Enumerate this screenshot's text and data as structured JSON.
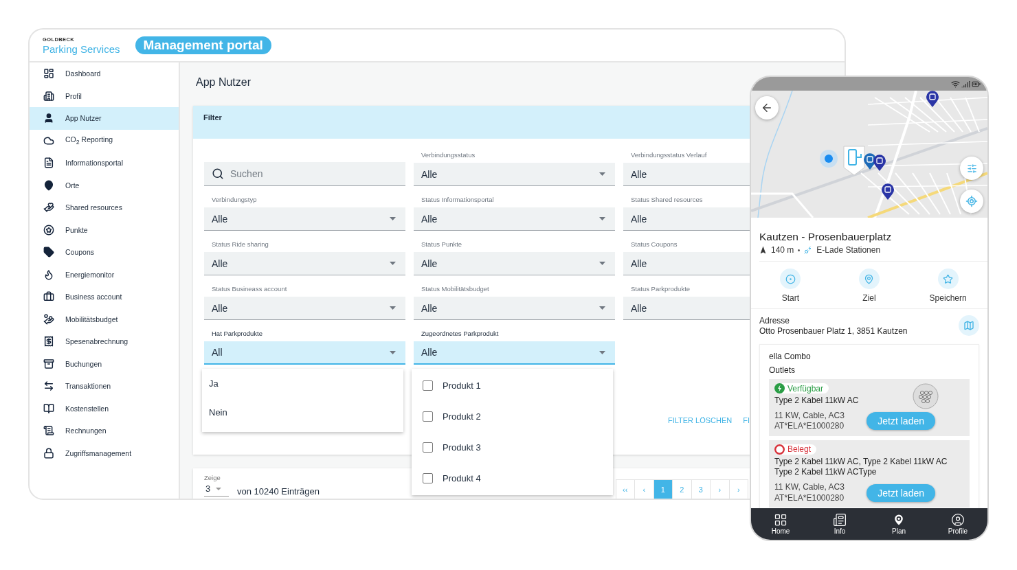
{
  "header": {
    "company": "GOLDBECK",
    "brand": "Parking Services",
    "badge": "Management portal"
  },
  "sidebar": {
    "items": [
      {
        "label": "Dashboard",
        "selected": false
      },
      {
        "label": "Profil",
        "selected": false
      },
      {
        "label": "App Nutzer",
        "selected": true
      },
      {
        "label": "CO$_{2}$ Reporting",
        "selected": false
      },
      {
        "label": "Informationsportal",
        "selected": false
      },
      {
        "label": "Orte",
        "selected": false
      },
      {
        "label": "Shared resources",
        "selected": false
      },
      {
        "label": "Punkte",
        "selected": false
      },
      {
        "label": "Coupons",
        "selected": false
      },
      {
        "label": "Energiemonitor",
        "selected": false
      },
      {
        "label": "Business account",
        "selected": false
      },
      {
        "label": "Mobilitätsbudget",
        "selected": false
      },
      {
        "label": "Spesenabrechnung",
        "selected": false
      },
      {
        "label": "Buchungen",
        "selected": false
      },
      {
        "label": "Transaktionen",
        "selected": false
      },
      {
        "label": "Kostenstellen",
        "selected": false
      },
      {
        "label": "Rechnungen",
        "selected": false
      },
      {
        "label": "Zugriffsmanagement",
        "selected": false
      }
    ]
  },
  "page": {
    "title": "App Nutzer"
  },
  "filter": {
    "title": "Filter",
    "fields": [
      {
        "kind": "search",
        "placeholder": "Suchen"
      },
      {
        "kind": "select",
        "label": "Verbindungsstatus",
        "value": "Alle",
        "open": false
      },
      {
        "kind": "select",
        "label": "Verbindungsstatus Verlauf",
        "value": "Alle",
        "open": false
      },
      {
        "kind": "select",
        "label": "Verbindungstyp",
        "value": "Alle",
        "open": false
      },
      {
        "kind": "select",
        "label": "Status Informationsportal",
        "value": "Alle",
        "open": false
      },
      {
        "kind": "select",
        "label": "Status Shared resources",
        "value": "Alle",
        "open": false
      },
      {
        "kind": "select",
        "label": "Status Ride sharing",
        "value": "Alle",
        "open": false
      },
      {
        "kind": "select",
        "label": "Status Punkte",
        "value": "Alle",
        "open": false
      },
      {
        "kind": "select",
        "label": "Status Coupons",
        "value": "Alle",
        "open": false
      },
      {
        "kind": "select",
        "label": "Status Busineass account",
        "value": "Alle",
        "open": false
      },
      {
        "kind": "select",
        "label": "Status Mobilitätsbudget",
        "value": "Alle",
        "open": false
      },
      {
        "kind": "select",
        "label": "Status Parkprodukte",
        "value": "Alle",
        "open": false
      },
      {
        "kind": "select",
        "label": "Hat Parkprodukte",
        "value": "All",
        "open": true,
        "menu": {
          "kind": "list",
          "options": [
            {
              "label": "Ja"
            },
            {
              "label": "Nein"
            }
          ]
        }
      },
      {
        "kind": "select",
        "label": "Zugeordnetes Parkprodukt",
        "value": "Alle",
        "open": true,
        "menu": {
          "kind": "checklist",
          "options": [
            {
              "label": "Produkt 1",
              "checked": false
            },
            {
              "label": "Produkt 2",
              "checked": false
            },
            {
              "label": "Produkt 3",
              "checked": false
            },
            {
              "label": "Produkt 4",
              "checked": false
            }
          ]
        }
      }
    ],
    "buttons": [
      "FILTER LÖSCHEN",
      "FI"
    ]
  },
  "pagination": {
    "show_label": "Zeige",
    "page_size": "3",
    "total": "von 10240 Einträgen",
    "pages": [
      {
        "label": "‹‹",
        "selected": false
      },
      {
        "label": "‹",
        "selected": false
      },
      {
        "label": "1",
        "selected": true
      },
      {
        "label": "2",
        "selected": false
      },
      {
        "label": "3",
        "selected": false
      },
      {
        "label": "›",
        "selected": false
      },
      {
        "label": "›",
        "selected": false
      }
    ]
  },
  "phone": {
    "place": {
      "title": "Kautzen - Prosenbauerplatz",
      "distance": "140 m",
      "category": "E-Lade Stationen"
    },
    "actions": [
      "Start",
      "Ziel",
      "Speichern"
    ],
    "address": {
      "label": "Adresse",
      "value": "Otto Prosenbauer Platz 1, 3851 Kautzen"
    },
    "station": {
      "name": "ella Combo",
      "section": "Outlets",
      "outlets": [
        {
          "status": "Verfügbar",
          "color": "#2a9d45",
          "kind": "available",
          "name": "Type 2 Kabel 11kW AC",
          "specs": "11 KW, Cable, AC3",
          "id": "AT*ELA*E1000280",
          "has_image": true,
          "button": "Jetzt laden"
        },
        {
          "status": "Belegt",
          "color": "#d8323b",
          "kind": "occupied",
          "name": "Type 2 Kabel 11kW AC, Type 2 Kabel 11kW AC Type 2 Kabel 11kW ACType",
          "specs": "11 KW, Cable, AC3",
          "id": "AT*ELA*E1000280",
          "has_image": false,
          "button": "Jetzt laden"
        }
      ]
    },
    "nav": [
      {
        "label": "Home",
        "selected": false
      },
      {
        "label": "Info",
        "selected": false
      },
      {
        "label": "Plan",
        "selected": true
      },
      {
        "label": "Profile",
        "selected": false
      }
    ]
  }
}
